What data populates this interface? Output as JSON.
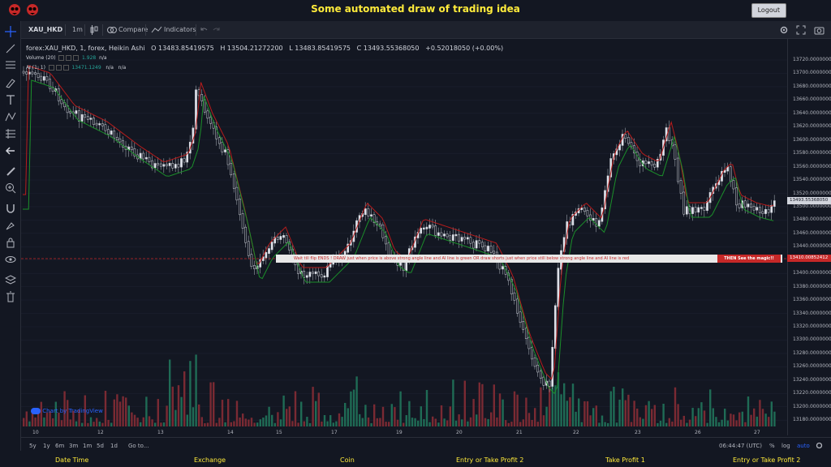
{
  "header": {
    "title": "Some automated draw of trading idea",
    "logout_label": "Logout"
  },
  "toolbar": {
    "symbol": "XAU_HKD",
    "interval": "1m",
    "compare_label": "Compare",
    "indicators_label": "Indicators"
  },
  "legend": {
    "main": "forex:XAU_HKD, 1, forex, Heikin Ashi",
    "open": "O 13483.85419575",
    "high": "H 13504.21272200",
    "low": "L 13483.85419575",
    "close": "C 13493.55368050",
    "change": "+0.52018050 (+0.00%)",
    "volume_label": "Volume (20)",
    "volume_value": "1.928",
    "volume_na": "n/a",
    "ai_label": "AI (1, 1)",
    "ai_value": "13471.1249",
    "ai_na1": "n/a",
    "ai_na2": "n/a"
  },
  "price_axis": {
    "ticks": [
      "13720.00000000",
      "13700.00000000",
      "13680.00000000",
      "13660.00000000",
      "13640.00000000",
      "13620.00000000",
      "13600.00000000",
      "13580.00000000",
      "13560.00000000",
      "13540.00000000",
      "13520.00000000",
      "13500.00000000",
      "13480.00000000",
      "13460.00000000",
      "13440.00000000",
      "13420.00000000",
      "13400.00000000",
      "13380.00000000",
      "13360.00000000",
      "13340.00000000",
      "13320.00000000",
      "13300.00000000",
      "13280.00000000",
      "13260.00000000",
      "13240.00000000",
      "13220.00000000",
      "13200.00000000",
      "13180.00000000"
    ],
    "current_price": "13493.55368050",
    "line_price": "13410.00852412"
  },
  "time_axis": {
    "labels": [
      "10",
      "12",
      "13",
      "14",
      "15",
      "17",
      "19",
      "20",
      "21",
      "22",
      "23",
      "26",
      "27"
    ]
  },
  "annotation": {
    "text": "Wait till flip ENDS !   DRAW just when   price is above strong angle line and AI line is green         OR        draw shorts just when price still below strong angle line and AI line is red",
    "right_text": "THEN See the magic!!"
  },
  "watermark": "Chart by TradingView",
  "range_bar": {
    "ranges": [
      "5y",
      "1y",
      "6m",
      "3m",
      "1m",
      "5d",
      "1d"
    ],
    "goto_label": "Go to...",
    "clock": "06:44:47 (UTC)",
    "percent_label": "%",
    "log_label": "log",
    "auto_label": "auto"
  },
  "footer": {
    "columns": [
      "Date Time",
      "Exchange",
      "Coin",
      "Entry or Take Profit 2",
      "Take Profit 1",
      "Entry or Take Profit 2"
    ]
  },
  "colors": {
    "up": "#26a69a",
    "down": "#ef5350",
    "title": "#ffeb3b",
    "background": "#131722"
  },
  "icons": {
    "left_tools": [
      "crosshair-icon",
      "trendline-icon",
      "fib-icon",
      "brush-icon",
      "text-icon",
      "pattern-icon",
      "measure-icon",
      "arrow-left-icon",
      "ruler-icon",
      "zoom-in-icon",
      "magnet-icon",
      "lock-drawings-icon",
      "lock-icon",
      "eye-icon",
      "layers-icon",
      "trash-icon"
    ]
  }
}
